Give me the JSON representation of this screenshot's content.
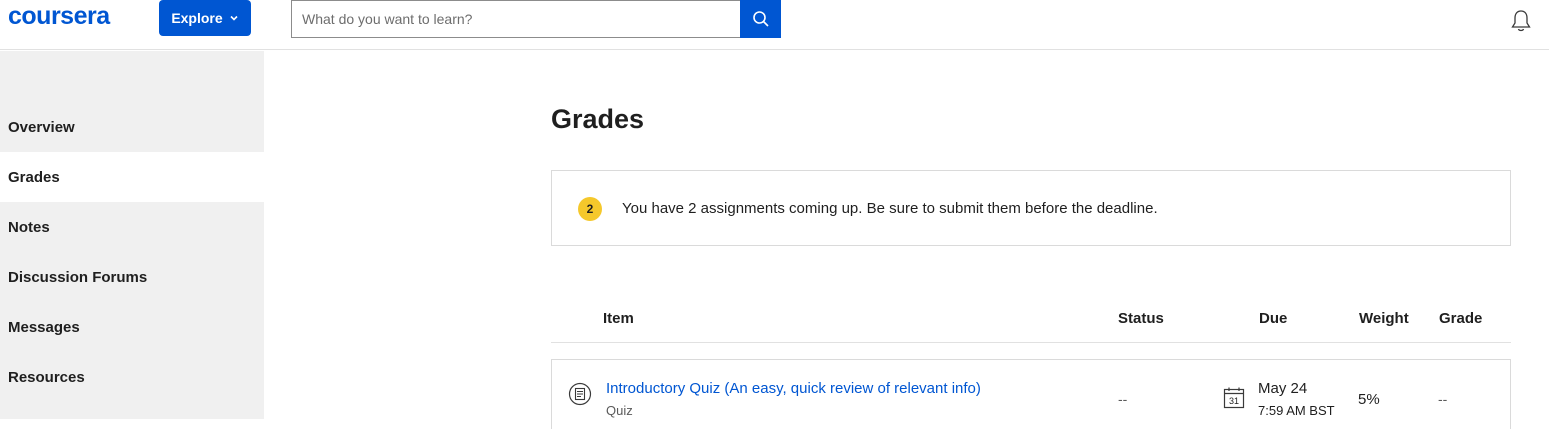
{
  "header": {
    "logo": "coursera",
    "explore_label": "Explore",
    "search_placeholder": "What do you want to learn?"
  },
  "sidebar": {
    "items": [
      {
        "label": "Overview"
      },
      {
        "label": "Grades"
      },
      {
        "label": "Notes"
      },
      {
        "label": "Discussion Forums"
      },
      {
        "label": "Messages"
      },
      {
        "label": "Resources"
      }
    ],
    "active": "Grades"
  },
  "main": {
    "title": "Grades",
    "notice": {
      "count": "2",
      "text": "You have 2 assignments coming up. Be sure to submit them before the deadline."
    },
    "table": {
      "headers": {
        "item": "Item",
        "status": "Status",
        "due": "Due",
        "weight": "Weight",
        "grade": "Grade"
      },
      "rows": [
        {
          "title": "Introductory Quiz (An easy, quick review of relevant info)",
          "type": "Quiz",
          "status": "--",
          "calendar_day": "31",
          "due_date": "May 24",
          "due_time": "7:59 AM BST",
          "weight": "5%",
          "grade": "--"
        }
      ]
    }
  },
  "colors": {
    "brand": "#0056d2",
    "badge": "#f5c82b",
    "sidebar_bg": "#f0f0f0"
  }
}
